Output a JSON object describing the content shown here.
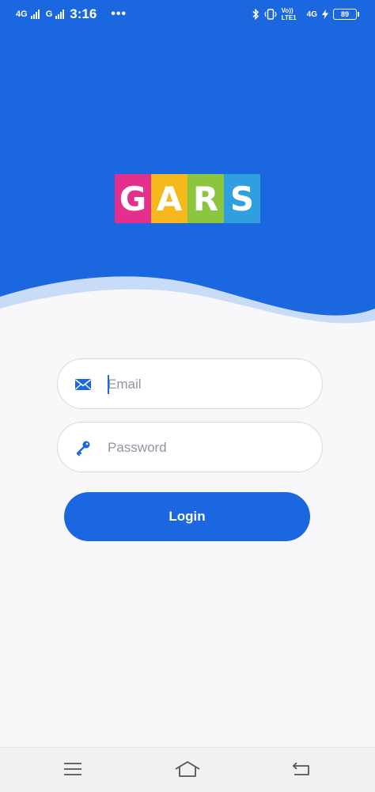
{
  "status_bar": {
    "net1": "4G",
    "net2": "G",
    "time": "3:16",
    "dots": "•••",
    "volte": "Vo)) LTE1",
    "net3": "4G",
    "battery": "89"
  },
  "logo": {
    "letters": [
      "G",
      "A",
      "R",
      "S"
    ],
    "colors": [
      "#e42f8d",
      "#f6b91d",
      "#8cc63e",
      "#2f9fdf"
    ]
  },
  "form": {
    "email": {
      "value": "",
      "placeholder": "Email"
    },
    "password": {
      "value": "",
      "placeholder": "Password"
    },
    "login_label": "Login"
  },
  "colors": {
    "primary": "#1a67e0",
    "background": "#f8f8fa"
  },
  "icons": [
    "mail-icon",
    "key-icon",
    "menu-icon",
    "home-icon",
    "back-icon"
  ]
}
